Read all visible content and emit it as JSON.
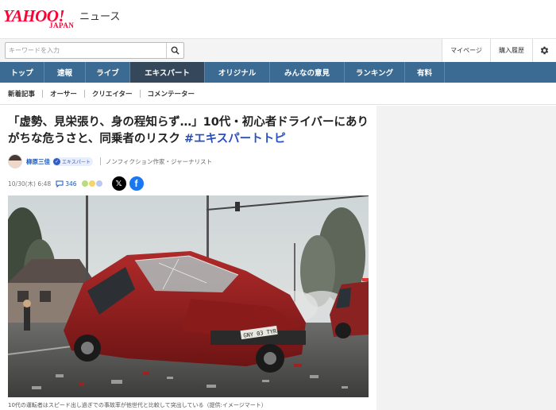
{
  "header": {
    "logo_main": "YAHOO!",
    "logo_sub": "JAPAN",
    "section": "ニュース"
  },
  "search": {
    "placeholder": "キーワードを入力"
  },
  "top_links": [
    "マイページ",
    "購入履歴"
  ],
  "nav": {
    "items": [
      {
        "label": "トップ",
        "width": 56
      },
      {
        "label": "速報",
        "width": 52
      },
      {
        "label": "ライブ",
        "width": 56
      },
      {
        "label": "エキスパート",
        "width": 94
      },
      {
        "label": "オリジナル",
        "width": 82
      },
      {
        "label": "みんなの意見",
        "width": 94
      },
      {
        "label": "ランキング",
        "width": 76
      },
      {
        "label": "有料",
        "width": 50
      }
    ],
    "active_index": 3
  },
  "subnav": [
    "新着記事",
    "オーサー",
    "クリエイター",
    "コメンテーター"
  ],
  "article": {
    "headline_main": "「虚勢、見栄張り、身の程知らず…」10代・初心者ドライバーにありがちな危うさと、同乗者のリスク ",
    "headline_tag": "#エキスパートトピ",
    "author_name": "柳原三佳",
    "expert_badge": "エキスパート",
    "author_title": "ノンフィクション作家・ジャーナリスト",
    "date": "10/30(木) 6:48",
    "comment_count": "346",
    "caption": "10代の運転者はスピード出し過ぎでの事故率が他世代と比較して突出している（提供:イメージマート）"
  },
  "photo": {
    "plate": "GNY 03 TYR"
  },
  "colors": {
    "nav_bg": "#3b6b92",
    "nav_active": "#35475a",
    "link_blue": "#1d56b4",
    "tag_blue": "#2a4fbf",
    "brand_red": "#ff0033"
  }
}
